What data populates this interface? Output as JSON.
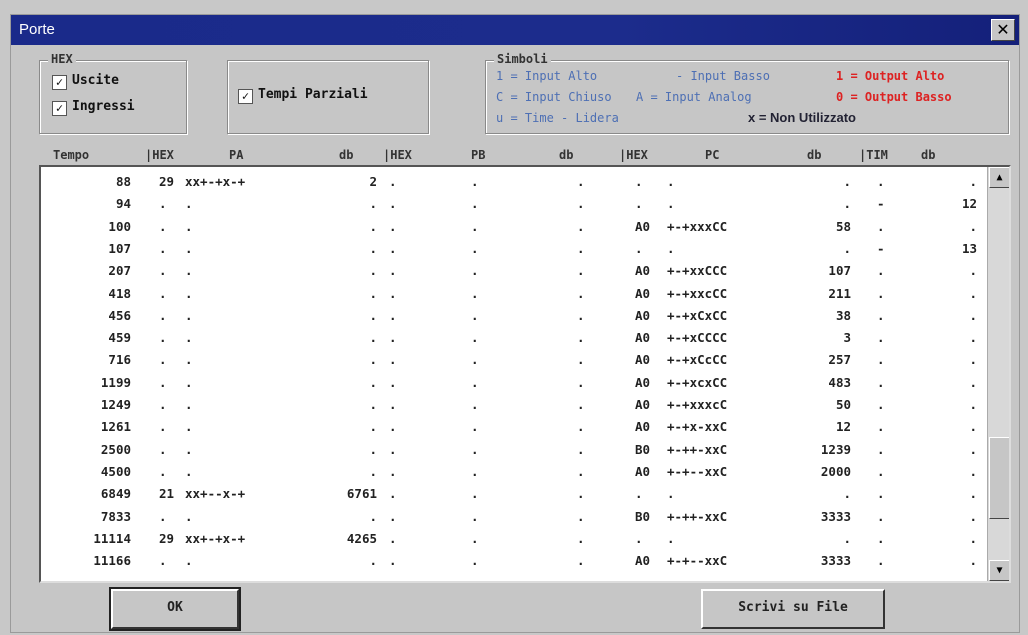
{
  "window": {
    "title": "Porte",
    "close_glyph": "✕"
  },
  "hex_group": {
    "legend": "HEX",
    "uscite": "Uscite",
    "ingressi": "Ingressi",
    "check": "✓"
  },
  "tempi": {
    "label": "Tempi Parziali"
  },
  "simboli": {
    "legend": "Simboli",
    "line1_a": "1 = Input Alto",
    "line1_b": "- Input Basso",
    "line1_c": "1 = Output Alto",
    "line2_a": "C = Input Chiuso",
    "line2_b": "A = Input Analog",
    "line2_c": "0 = Output Basso",
    "line3_a": "u = Time - Lidera",
    "line3_b": "x = Non Utilizzato"
  },
  "columns": [
    "Tempo",
    "|HEX",
    "PA",
    "db",
    "|HEX",
    "PB",
    "db",
    "|HEX",
    "PC",
    "db",
    "|TIM",
    "db"
  ],
  "rows": [
    [
      "88",
      "29",
      "xx+-+x-+",
      "2",
      ".",
      ".",
      ".",
      ".",
      ".",
      ".",
      ".",
      "."
    ],
    [
      "94",
      ".",
      ".",
      ".",
      ".",
      ".",
      ".",
      ".",
      ".",
      ".",
      "-",
      "12"
    ],
    [
      "100",
      ".",
      ".",
      ".",
      ".",
      ".",
      ".",
      "A0",
      "+-+xxxCC",
      "58",
      ".",
      "."
    ],
    [
      "107",
      ".",
      ".",
      ".",
      ".",
      ".",
      ".",
      ".",
      ".",
      ".",
      "-",
      "13"
    ],
    [
      "207",
      ".",
      ".",
      ".",
      ".",
      ".",
      ".",
      "A0",
      "+-+xxCCC",
      "107",
      ".",
      "."
    ],
    [
      "418",
      ".",
      ".",
      ".",
      ".",
      ".",
      ".",
      "A0",
      "+-+xxcCC",
      "211",
      ".",
      "."
    ],
    [
      "456",
      ".",
      ".",
      ".",
      ".",
      ".",
      ".",
      "A0",
      "+-+xCxCC",
      "38",
      ".",
      "."
    ],
    [
      "459",
      ".",
      ".",
      ".",
      ".",
      ".",
      ".",
      "A0",
      "+-+xCCCC",
      "3",
      ".",
      "."
    ],
    [
      "716",
      ".",
      ".",
      ".",
      ".",
      ".",
      ".",
      "A0",
      "+-+xCcCC",
      "257",
      ".",
      "."
    ],
    [
      "1199",
      ".",
      ".",
      ".",
      ".",
      ".",
      ".",
      "A0",
      "+-+xcxCC",
      "483",
      ".",
      "."
    ],
    [
      "1249",
      ".",
      ".",
      ".",
      ".",
      ".",
      ".",
      "A0",
      "+-+xxxcC",
      "50",
      ".",
      "."
    ],
    [
      "1261",
      ".",
      ".",
      ".",
      ".",
      ".",
      ".",
      "A0",
      "+-+x-xxC",
      "12",
      ".",
      "."
    ],
    [
      "2500",
      ".",
      ".",
      ".",
      ".",
      ".",
      ".",
      "B0",
      "+-++-xxC",
      "1239",
      ".",
      "."
    ],
    [
      "4500",
      ".",
      ".",
      ".",
      ".",
      ".",
      ".",
      "A0",
      "+-+--xxC",
      "2000",
      ".",
      "."
    ],
    [
      "6849",
      "21",
      "xx+--x-+",
      "6761",
      ".",
      ".",
      ".",
      ".",
      ".",
      ".",
      ".",
      "."
    ],
    [
      "7833",
      ".",
      ".",
      ".",
      ".",
      ".",
      ".",
      "B0",
      "+-++-xxC",
      "3333",
      ".",
      "."
    ],
    [
      "11114",
      "29",
      "xx+-+x-+",
      "4265",
      ".",
      ".",
      ".",
      ".",
      ".",
      ".",
      ".",
      "."
    ],
    [
      "11166",
      ".",
      ".",
      ".",
      ".",
      ".",
      ".",
      "A0",
      "+-+--xxC",
      "3333",
      ".",
      "."
    ]
  ],
  "buttons": {
    "ok": "OK",
    "scrivi": "Scrivi su File"
  },
  "scroll": {
    "up": "▲",
    "down": "▼"
  },
  "colors": {
    "title_bar": "#1a2a8a",
    "symbol_blue": "#4d6fb4",
    "symbol_red": "#dd2222"
  }
}
